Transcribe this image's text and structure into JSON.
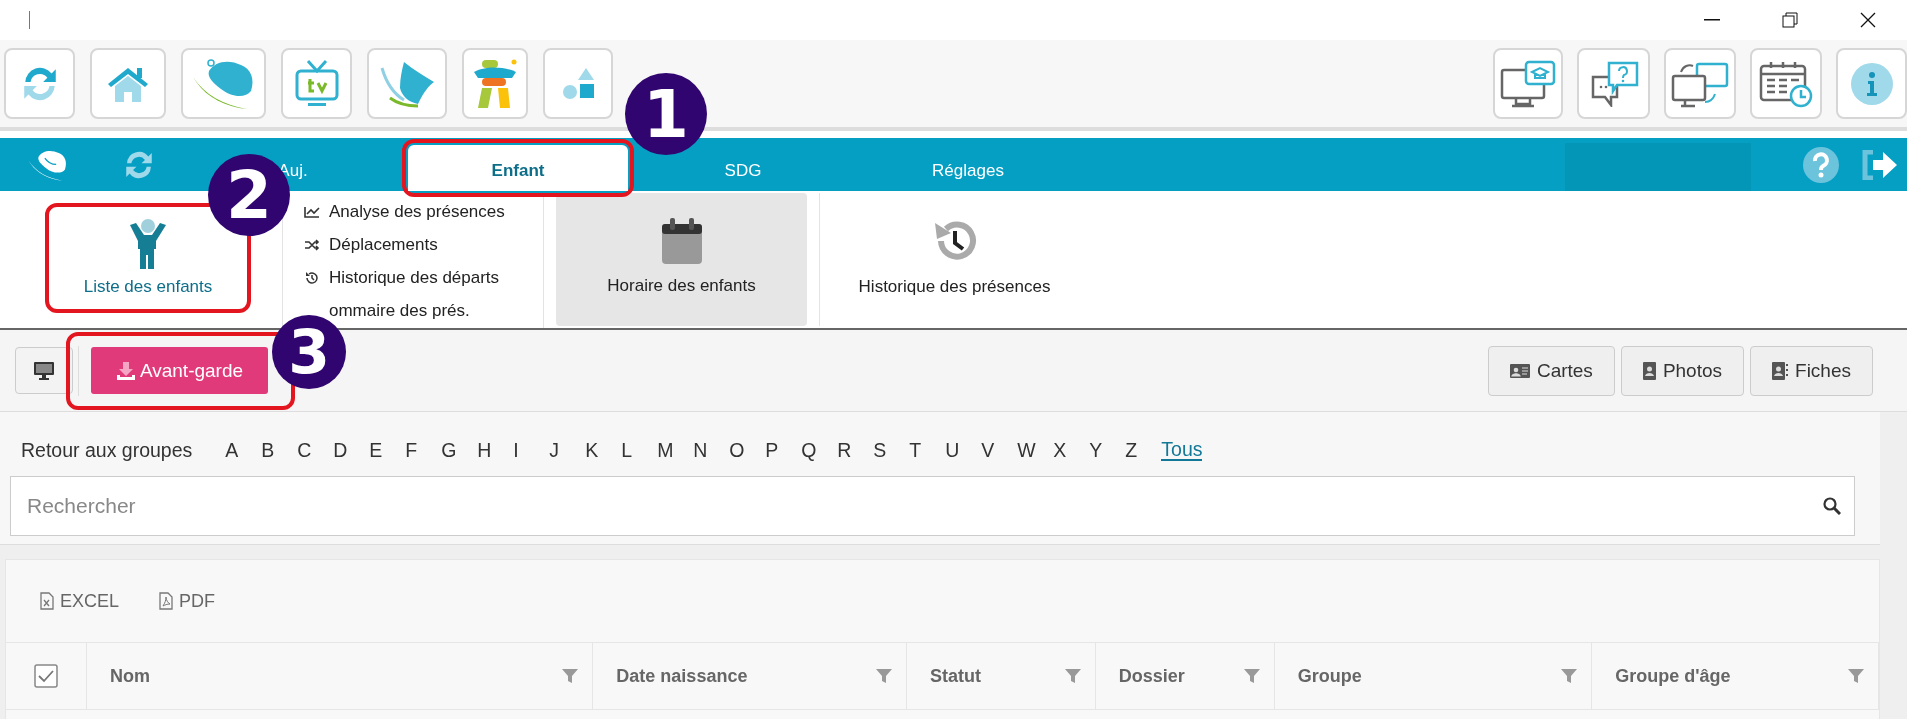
{
  "toolbar": {
    "left": [
      {
        "kind": "sync"
      },
      {
        "kind": "home"
      },
      {
        "kind": "bird"
      },
      {
        "kind": "tv"
      },
      {
        "kind": "leaf"
      },
      {
        "kind": "figure"
      },
      {
        "kind": "shapes"
      }
    ],
    "right": [
      {
        "kind": "monitor-cap"
      },
      {
        "kind": "chat"
      },
      {
        "kind": "monitors"
      },
      {
        "kind": "calendar-clock"
      },
      {
        "kind": "info"
      }
    ]
  },
  "nav": {
    "tabs": [
      {
        "label": "Auj.",
        "selected": false
      },
      {
        "label": "Enfant",
        "selected": true
      },
      {
        "label": "SDG",
        "selected": false
      },
      {
        "label": "Réglages",
        "selected": false
      }
    ]
  },
  "ribbon": {
    "main_item": {
      "label": "Liste des enfants"
    },
    "links": [
      {
        "kind": "chart",
        "label": "Analyse des présences"
      },
      {
        "kind": "shuffle",
        "label": "Déplacements"
      },
      {
        "kind": "history",
        "label": "Historique des départs"
      },
      {
        "kind": "hidden",
        "label": "ommaire des prés."
      }
    ],
    "cards": [
      {
        "kind": "calendar",
        "label": "Horaire des enfants",
        "selected": true
      },
      {
        "kind": "history",
        "label": "Historique des présences",
        "selected": false
      }
    ]
  },
  "actions": {
    "download_button": {
      "label": "Avant-garde"
    },
    "right": [
      {
        "kind": "card",
        "label": "Cartes"
      },
      {
        "kind": "photo",
        "label": "Photos"
      },
      {
        "kind": "file",
        "label": "Fiches"
      }
    ]
  },
  "filter": {
    "back_link": "Retour aux groupes",
    "letters": [
      {
        "label": "A",
        "selected": false
      },
      {
        "label": "B",
        "selected": false
      },
      {
        "label": "C",
        "selected": false
      },
      {
        "label": "D",
        "selected": false
      },
      {
        "label": "E",
        "selected": false
      },
      {
        "label": "F",
        "selected": false
      },
      {
        "label": "G",
        "selected": false
      },
      {
        "label": "H",
        "selected": false
      },
      {
        "label": "I",
        "selected": false
      },
      {
        "label": "J",
        "selected": false
      },
      {
        "label": "K",
        "selected": false
      },
      {
        "label": "L",
        "selected": false
      },
      {
        "label": "M",
        "selected": false
      },
      {
        "label": "N",
        "selected": false
      },
      {
        "label": "O",
        "selected": false
      },
      {
        "label": "P",
        "selected": false
      },
      {
        "label": "Q",
        "selected": false
      },
      {
        "label": "R",
        "selected": false
      },
      {
        "label": "S",
        "selected": false
      },
      {
        "label": "T",
        "selected": false
      },
      {
        "label": "U",
        "selected": false
      },
      {
        "label": "V",
        "selected": false
      },
      {
        "label": "W",
        "selected": false
      },
      {
        "label": "X",
        "selected": false
      },
      {
        "label": "Y",
        "selected": false
      },
      {
        "label": "Z",
        "selected": false
      },
      {
        "label": "Tous",
        "selected": true
      }
    ]
  },
  "search": {
    "placeholder": "Rechercher"
  },
  "export": [
    {
      "kind": "excel",
      "label": "EXCEL"
    },
    {
      "kind": "pdf",
      "label": "PDF"
    }
  ],
  "table": {
    "select_all": {
      "checked": true
    },
    "columns": [
      "Nom",
      "Date naissance",
      "Statut",
      "Dossier",
      "Groupe",
      "Groupe d'âge"
    ]
  },
  "annotations": [
    {
      "number": "1"
    },
    {
      "number": "2"
    },
    {
      "number": "3"
    }
  ]
}
